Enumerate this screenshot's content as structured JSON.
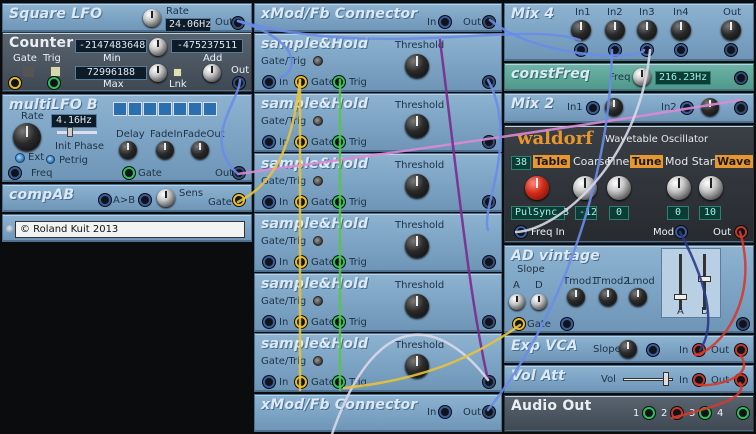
{
  "modules": {
    "square_lfo": {
      "title": "Square LFO",
      "rate_label": "Rate",
      "rate_value": "24.06Hz",
      "out_label": "Out"
    },
    "counter": {
      "title": "Counter",
      "gate_label": "Gate",
      "trig_label": "Trig",
      "value1": "-2147483648",
      "value2": "-475237511",
      "min_label": "Min",
      "add_label": "Add",
      "value3": "72996188",
      "max_label": "Max",
      "lnk_label": "Lnk",
      "out_label": "Out"
    },
    "multilfo": {
      "title": "multiLFO B",
      "rate_label": "Rate",
      "rate_value": "4.16Hz",
      "ext_label": "Ext",
      "init_phase_label": "Init Phase",
      "petrig_label": "Petrig",
      "freq_label": "Freq",
      "delay_label": "Delay",
      "fadein_label": "FadeIn",
      "fadeout_label": "FadeOut",
      "gate_label": "Gate",
      "out_label": "Out"
    },
    "compab": {
      "title": "compAB",
      "ab_label": "A>B",
      "sens_label": "Sens",
      "gate_label": "Gate"
    },
    "copyright": {
      "text": "© Roland Kuit 2013"
    },
    "xmod_top": {
      "title": "xMod/Fb Connector",
      "in_label": "In",
      "out_label": "Out"
    },
    "xmod_bottom": {
      "title": "xMod/Fb Connector",
      "in_label": "In",
      "out_label": "Out"
    },
    "sample_hold": [
      {
        "title": "sample&Hold",
        "gatetrig_label": "Gate/Trig",
        "threshold_label": "Threshold",
        "in_label": "In",
        "gate_label": "Gate",
        "trig_label": "Trig"
      },
      {
        "title": "sample&Hold",
        "gatetrig_label": "Gate/Trig",
        "threshold_label": "Threshold",
        "in_label": "In",
        "gate_label": "Gate",
        "trig_label": "Trig"
      },
      {
        "title": "sample&Hold",
        "gatetrig_label": "Gate/Trig",
        "threshold_label": "Threshold",
        "in_label": "In",
        "gate_label": "Gate",
        "trig_label": "Trig"
      },
      {
        "title": "sample&Hold",
        "gatetrig_label": "Gate/Trig",
        "threshold_label": "Threshold",
        "in_label": "In",
        "gate_label": "Gate",
        "trig_label": "Trig"
      },
      {
        "title": "sample&Hold",
        "gatetrig_label": "Gate/Trig",
        "threshold_label": "Threshold",
        "in_label": "In",
        "gate_label": "Gate",
        "trig_label": "Trig"
      },
      {
        "title": "sample&Hold",
        "gatetrig_label": "Gate/Trig",
        "threshold_label": "Threshold",
        "in_label": "In",
        "gate_label": "Gate",
        "trig_label": "Trig"
      }
    ],
    "mix4": {
      "title": "Mix 4",
      "in1": "In1",
      "in2": "In2",
      "in3": "In3",
      "in4": "In4",
      "out_label": "Out"
    },
    "constfreq": {
      "title": "constFreq",
      "freq_label": "Freq",
      "freq_value": "216.23Hz"
    },
    "mix2": {
      "title": "Mix 2",
      "in1": "In1",
      "in2": "In2",
      "out_label": "Out"
    },
    "waldorf": {
      "brand": "waldorf",
      "subtitle": "Wavetable Oscillator",
      "table_num": "38",
      "table_label": "Table",
      "coarse_label": "Coarse",
      "fine_label": "Fine",
      "tune_label": "Tune",
      "modstart_label": "Mod Start",
      "wave_label": "Wave",
      "sync_value": "PulSync 3",
      "coarse_value": "-12",
      "fine_value": "0",
      "modstart_value": "0",
      "wave_value": "10",
      "freqin_label": "Freq In",
      "mod_label": "Mod",
      "out_label": "Out"
    },
    "ad_vintage": {
      "title": "AD vintage",
      "slope_label": "Slope",
      "a_label": "A",
      "d_label": "D",
      "tmod1_label": "Tmod1",
      "tmod2_label": "Tmod2",
      "lmod_label": "Lmod",
      "gate_label": "Gate",
      "fader_a_label": "A",
      "fader_d_label": "D"
    },
    "exp_vca": {
      "title": "Exp VCA",
      "slope_label": "Slope",
      "in_label": "In",
      "out_label": "Out"
    },
    "vol_att": {
      "title": "Vol Att",
      "vol_label": "Vol",
      "in_label": "In",
      "out_label": "Out"
    },
    "audio_out": {
      "title": "Audio Out",
      "ch1": "1",
      "ch2": "2",
      "ch3": "3",
      "ch4": "4"
    }
  },
  "cable_colors": {
    "blue": "#6a8ce8",
    "pink": "#d98ad6",
    "yellow": "#e8c23a",
    "green": "#58c34c",
    "purple": "#7b2a8f",
    "white": "#d8d8e8",
    "red": "#d53a2c",
    "navy": "#2b3a8a"
  }
}
